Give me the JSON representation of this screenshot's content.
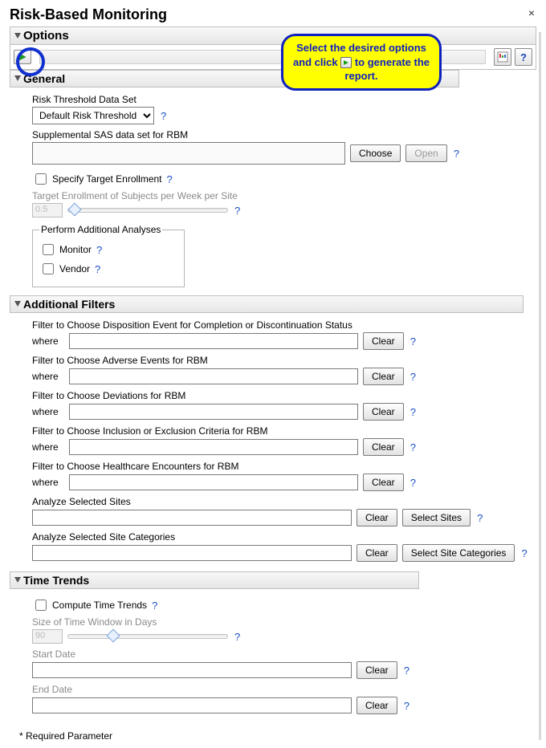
{
  "title": "Risk-Based Monitoring",
  "close_glyph": "×",
  "callout": {
    "line1": "Select the desired options and click",
    "line2": "to generate the report."
  },
  "options_head": "Options",
  "general": {
    "head": "General",
    "risk_threshold_label": "Risk Threshold Data Set",
    "risk_threshold_value": "Default Risk Threshold",
    "supp_label": "Supplemental SAS data set for RBM",
    "choose_btn": "Choose",
    "open_btn": "Open",
    "specify_target_label": "Specify Target Enrollment",
    "target_enroll_label": "Target Enrollment of Subjects per Week per Site",
    "target_enroll_value": "0.5",
    "perform_legend": "Perform Additional Analyses",
    "monitor_label": "Monitor",
    "vendor_label": "Vendor"
  },
  "filters": {
    "head": "Additional Filters",
    "where": "where",
    "clear": "Clear",
    "f1": "Filter to Choose Disposition Event for Completion or Discontinuation Status",
    "f2": "Filter to Choose Adverse Events for RBM",
    "f3": "Filter to Choose Deviations for RBM",
    "f4": "Filter to Choose Inclusion or Exclusion Criteria for RBM",
    "f5": "Filter to Choose Healthcare Encounters for RBM",
    "analyze_sites": "Analyze Selected Sites",
    "select_sites_btn": "Select Sites",
    "analyze_cats": "Analyze Selected Site Categories",
    "select_cats_btn": "Select Site Categories"
  },
  "trends": {
    "head": "Time Trends",
    "compute_label": "Compute Time Trends",
    "window_label": "Size of Time Window in Days",
    "window_value": "90",
    "start_label": "Start Date",
    "end_label": "End Date"
  },
  "required_note": "* Required Parameter",
  "help_glyph": "?"
}
